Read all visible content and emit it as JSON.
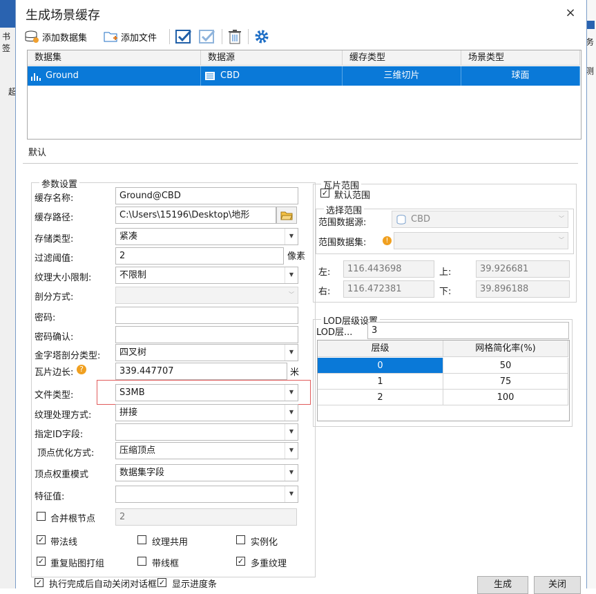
{
  "background": {
    "left_items": [
      "书签",
      "超"
    ],
    "right_items": [
      "务",
      "测"
    ]
  },
  "dialog": {
    "title": "生成场景缓存",
    "close": "×"
  },
  "toolbar": {
    "add_dataset": "添加数据集",
    "add_file": "添加文件"
  },
  "grid": {
    "headers": [
      "数据集",
      "数据源",
      "缓存类型",
      "场景类型"
    ],
    "rows": [
      {
        "dataset": "Ground",
        "datasource": "CBD",
        "cache_type": "三维切片",
        "scene_type": "球面"
      }
    ]
  },
  "tab": {
    "default": "默认"
  },
  "params": {
    "group": "参数设置",
    "cache_name_label": "缓存名称:",
    "cache_name": "Ground@CBD",
    "cache_path_label": "缓存路径:",
    "cache_path": "C:\\Users\\15196\\Desktop\\地形",
    "storage_type_label": "存储类型:",
    "storage_type": "紧凑",
    "filter_label": "过滤阈值:",
    "filter_value": "2",
    "filter_unit": "像素",
    "texture_size_label": "纹理大小限制:",
    "texture_size": "不限制",
    "split_label": "剖分方式:",
    "password_label": "密码:",
    "password_confirm_label": "密码确认:",
    "pyramid_label": "金字塔剖分类型:",
    "pyramid": "四叉树",
    "tile_side_label": "瓦片边长:",
    "tile_side": "339.447707",
    "tile_side_unit": "米",
    "file_type_label": "文件类型:",
    "file_type": "S3MB",
    "texture_mode_label": "纹理处理方式:",
    "texture_mode": "拼接",
    "id_field_label": "指定ID字段:",
    "vertex_opt_label": "顶点优化方式:",
    "vertex_opt": "压缩顶点",
    "vertex_weight_label": "顶点权重模式",
    "vertex_weight": "数据集字段",
    "feature_label": "特征值:",
    "merge_root_label": "合并根节点",
    "merge_root_value": "2",
    "normals_label": "带法线",
    "texture_share_label": "纹理共用",
    "instancing_label": "实例化",
    "repeat_texture_label": "重复贴图打组",
    "wireframe_label": "带线框",
    "multi_texture_label": "多重纹理"
  },
  "tile_range": {
    "group": "瓦片范围",
    "default_range": "默认范围",
    "select_group": "选择范围",
    "datasource_label": "范围数据源:",
    "datasource": "CBD",
    "dataset_label": "范围数据集:",
    "left_label": "左:",
    "left": "116.443698",
    "top_label": "上:",
    "top": "39.926681",
    "right_label": "右:",
    "right": "116.472381",
    "bottom_label": "下:",
    "bottom": "39.896188"
  },
  "lod": {
    "group": "LOD层级设置",
    "layers_label": "LOD层...",
    "layers": "3",
    "headers": [
      "层级",
      "网格简化率(%)"
    ],
    "rows": [
      {
        "level": "0",
        "rate": "50"
      },
      {
        "level": "1",
        "rate": "75"
      },
      {
        "level": "2",
        "rate": "100"
      }
    ]
  },
  "footer": {
    "auto_close": "执行完成后自动关闭对话框",
    "show_progress": "显示进度条",
    "generate": "生成",
    "close": "关闭"
  },
  "colors": {
    "selection": "#0a79d8",
    "highlight_box": "#e05a5a",
    "accent_icon": "#1f6fc6"
  }
}
